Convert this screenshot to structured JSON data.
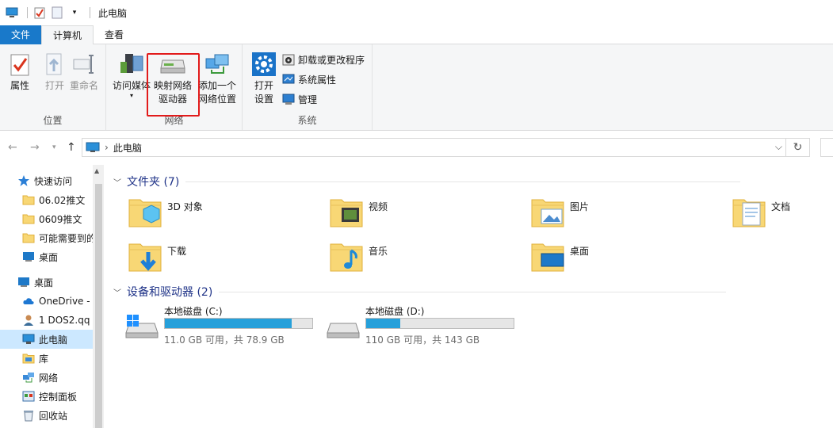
{
  "window": {
    "title": "此电脑"
  },
  "tabs": [
    {
      "label": "文件",
      "kind": "file"
    },
    {
      "label": "计算机",
      "kind": "active"
    },
    {
      "label": "查看",
      "kind": "normal"
    }
  ],
  "ribbon": {
    "location_group": {
      "label": "位置",
      "properties": "属性",
      "open": "打开",
      "rename": "重命名"
    },
    "network_group": {
      "label": "网络",
      "access_media_line1": "访问媒体",
      "map_drive_line1": "映射网络",
      "map_drive_line2": "驱动器",
      "add_location_line1": "添加一个",
      "add_location_line2": "网络位置"
    },
    "system_group": {
      "label": "系统",
      "open_settings_line1": "打开",
      "open_settings_line2": "设置",
      "uninstall": "卸载或更改程序",
      "system_properties": "系统属性",
      "manage": "管理"
    }
  },
  "address": {
    "path": "此电脑"
  },
  "sidebar": {
    "items": [
      {
        "label": "快速访问",
        "icon": "star-icon"
      },
      {
        "label": "06.02推文",
        "icon": "folder-icon"
      },
      {
        "label": "0609推文",
        "icon": "folder-icon"
      },
      {
        "label": "可能需要到的",
        "icon": "folder-icon"
      },
      {
        "label": "桌面",
        "icon": "desktop-icon"
      },
      {
        "label": "桌面",
        "icon": "desktop-icon"
      },
      {
        "label": "OneDrive - Pe",
        "icon": "cloud-icon"
      },
      {
        "label": "1 DOS2.qq",
        "icon": "user-icon"
      },
      {
        "label": "此电脑",
        "icon": "pc-icon"
      },
      {
        "label": "库",
        "icon": "library-icon"
      },
      {
        "label": "网络",
        "icon": "network-icon"
      },
      {
        "label": "控制面板",
        "icon": "control-panel-icon"
      },
      {
        "label": "回收站",
        "icon": "recycle-bin-icon"
      }
    ]
  },
  "folders_section": {
    "title": "文件夹 (7)"
  },
  "folders": [
    {
      "name": "3D 对象",
      "icon": "3d-objects-folder-icon"
    },
    {
      "name": "视频",
      "icon": "videos-folder-icon"
    },
    {
      "name": "图片",
      "icon": "pictures-folder-icon"
    },
    {
      "name": "文档",
      "icon": "documents-folder-icon"
    },
    {
      "name": "下载",
      "icon": "downloads-folder-icon"
    },
    {
      "name": "音乐",
      "icon": "music-folder-icon"
    },
    {
      "name": "桌面",
      "icon": "desktop-folder-icon"
    }
  ],
  "drives_section": {
    "title": "设备和驱动器 (2)"
  },
  "drives": [
    {
      "name": "本地磁盘 (C:)",
      "free": "11.0 GB 可用，共 78.9 GB",
      "used_fraction": 0.86
    },
    {
      "name": "本地磁盘 (D:)",
      "free": "110 GB 可用，共 143 GB",
      "used_fraction": 0.23
    }
  ],
  "colors": {
    "accent": "#1979ca",
    "drive_fill": "#26a0da",
    "highlight": "#e21b1b",
    "selected": "#cce8ff"
  }
}
